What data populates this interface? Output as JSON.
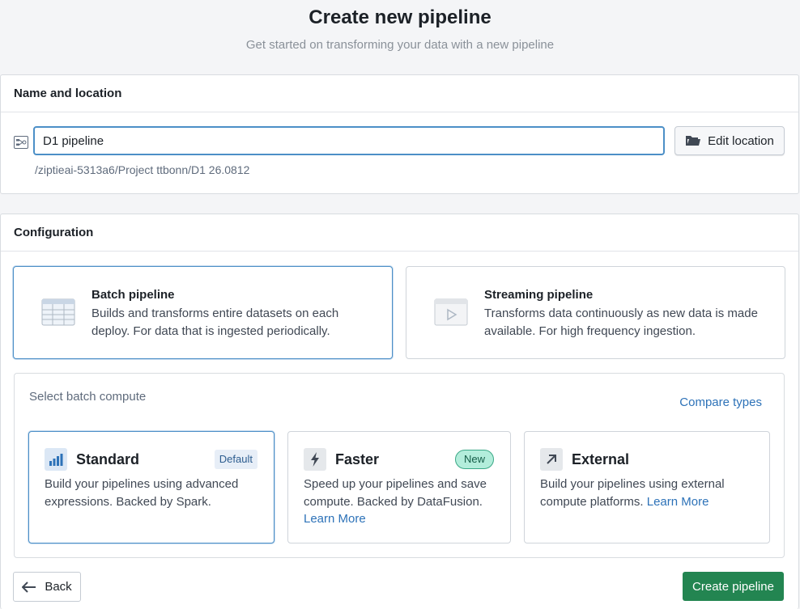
{
  "header": {
    "title": "Create new pipeline",
    "subtitle": "Get started on transforming your data with a new pipeline"
  },
  "name_section": {
    "title": "Name and location",
    "name_value": "D1 pipeline",
    "edit_location_label": "Edit location",
    "path": "/ziptieai-5313a6/Project ttbonn/D1 26.0812"
  },
  "config_section": {
    "title": "Configuration",
    "pipeline_types": [
      {
        "title": "Batch pipeline",
        "description": "Builds and transforms entire datasets on each deploy. For data that is ingested periodically.",
        "selected": true
      },
      {
        "title": "Streaming pipeline",
        "description": "Transforms data continuously as new data is made available. For high frequency ingestion.",
        "selected": false
      }
    ],
    "compute": {
      "label": "Select batch compute",
      "compare_link": "Compare types",
      "options": [
        {
          "title": "Standard",
          "badge": "Default",
          "description": "Build your pipelines using advanced expressions. Backed by Spark.",
          "icon": "bar-chart-icon",
          "selected": true
        },
        {
          "title": "Faster",
          "badge": "New",
          "description": "Speed up your pipelines and save compute. Backed by DataFusion.",
          "link": "Learn More",
          "icon": "lightning-icon",
          "selected": false
        },
        {
          "title": "External",
          "description": "Build your pipelines using external compute platforms.",
          "link": "Learn More",
          "icon": "arrow-up-right-icon",
          "selected": false
        }
      ]
    }
  },
  "footer": {
    "back_label": "Back",
    "create_label": "Create pipeline"
  },
  "colors": {
    "primary_blue": "#2d72b8",
    "selected_border": "#4c8fc7",
    "create_green": "#238551"
  }
}
